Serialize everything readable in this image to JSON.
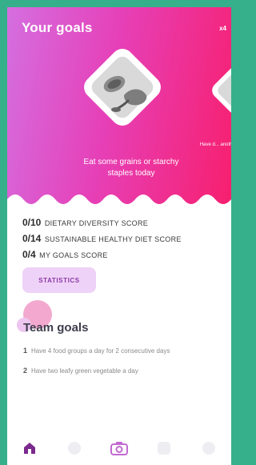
{
  "header": {
    "title": "Your goals",
    "counter": "x4"
  },
  "goal_cards": [
    {
      "caption": "Eat some grains or starchy staples today",
      "icon": "grains-illustration-icon"
    },
    {
      "caption": "Have d... another f...",
      "icon": "goal-illustration-icon"
    }
  ],
  "scores": [
    {
      "value": "0/10",
      "label": "DIETARY DIVERSITY SCORE"
    },
    {
      "value": "0/14",
      "label": "SUSTAINABLE HEALTHY DIET SCORE"
    },
    {
      "value": "0/4",
      "label": "MY GOALS SCORE"
    }
  ],
  "statistics_button": "STATISTICS",
  "team_goals": {
    "title": "Team goals",
    "items": [
      {
        "num": "1",
        "text": "Have 4 food groups a day for 2 consecutive days"
      },
      {
        "num": "2",
        "text": "Have two leafy green vegetable a day"
      }
    ]
  },
  "nav": {
    "items": [
      "home-icon",
      "community-icon",
      "camera-icon",
      "diary-icon",
      "profile-icon"
    ],
    "active_index": 0
  },
  "colors": {
    "frame": "#35b08a",
    "gradient_start": "#d46fe0",
    "gradient_end": "#f71f6e",
    "accent_purple": "#8a3aa6",
    "nav_active": "#7b2a8c"
  }
}
